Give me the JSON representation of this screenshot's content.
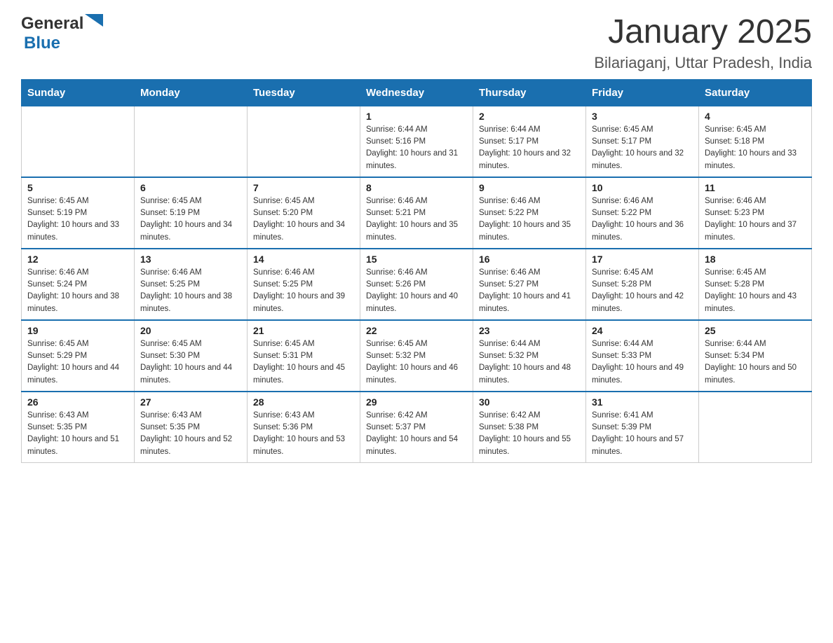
{
  "header": {
    "logo": {
      "text_general": "General",
      "text_blue": "Blue",
      "arrow_color": "#1a6faf"
    },
    "title": "January 2025",
    "subtitle": "Bilariaganj, Uttar Pradesh, India"
  },
  "days_of_week": [
    "Sunday",
    "Monday",
    "Tuesday",
    "Wednesday",
    "Thursday",
    "Friday",
    "Saturday"
  ],
  "weeks": [
    {
      "days": [
        {
          "num": "",
          "info": ""
        },
        {
          "num": "",
          "info": ""
        },
        {
          "num": "",
          "info": ""
        },
        {
          "num": "1",
          "info": "Sunrise: 6:44 AM\nSunset: 5:16 PM\nDaylight: 10 hours and 31 minutes."
        },
        {
          "num": "2",
          "info": "Sunrise: 6:44 AM\nSunset: 5:17 PM\nDaylight: 10 hours and 32 minutes."
        },
        {
          "num": "3",
          "info": "Sunrise: 6:45 AM\nSunset: 5:17 PM\nDaylight: 10 hours and 32 minutes."
        },
        {
          "num": "4",
          "info": "Sunrise: 6:45 AM\nSunset: 5:18 PM\nDaylight: 10 hours and 33 minutes."
        }
      ]
    },
    {
      "days": [
        {
          "num": "5",
          "info": "Sunrise: 6:45 AM\nSunset: 5:19 PM\nDaylight: 10 hours and 33 minutes."
        },
        {
          "num": "6",
          "info": "Sunrise: 6:45 AM\nSunset: 5:19 PM\nDaylight: 10 hours and 34 minutes."
        },
        {
          "num": "7",
          "info": "Sunrise: 6:45 AM\nSunset: 5:20 PM\nDaylight: 10 hours and 34 minutes."
        },
        {
          "num": "8",
          "info": "Sunrise: 6:46 AM\nSunset: 5:21 PM\nDaylight: 10 hours and 35 minutes."
        },
        {
          "num": "9",
          "info": "Sunrise: 6:46 AM\nSunset: 5:22 PM\nDaylight: 10 hours and 35 minutes."
        },
        {
          "num": "10",
          "info": "Sunrise: 6:46 AM\nSunset: 5:22 PM\nDaylight: 10 hours and 36 minutes."
        },
        {
          "num": "11",
          "info": "Sunrise: 6:46 AM\nSunset: 5:23 PM\nDaylight: 10 hours and 37 minutes."
        }
      ]
    },
    {
      "days": [
        {
          "num": "12",
          "info": "Sunrise: 6:46 AM\nSunset: 5:24 PM\nDaylight: 10 hours and 38 minutes."
        },
        {
          "num": "13",
          "info": "Sunrise: 6:46 AM\nSunset: 5:25 PM\nDaylight: 10 hours and 38 minutes."
        },
        {
          "num": "14",
          "info": "Sunrise: 6:46 AM\nSunset: 5:25 PM\nDaylight: 10 hours and 39 minutes."
        },
        {
          "num": "15",
          "info": "Sunrise: 6:46 AM\nSunset: 5:26 PM\nDaylight: 10 hours and 40 minutes."
        },
        {
          "num": "16",
          "info": "Sunrise: 6:46 AM\nSunset: 5:27 PM\nDaylight: 10 hours and 41 minutes."
        },
        {
          "num": "17",
          "info": "Sunrise: 6:45 AM\nSunset: 5:28 PM\nDaylight: 10 hours and 42 minutes."
        },
        {
          "num": "18",
          "info": "Sunrise: 6:45 AM\nSunset: 5:28 PM\nDaylight: 10 hours and 43 minutes."
        }
      ]
    },
    {
      "days": [
        {
          "num": "19",
          "info": "Sunrise: 6:45 AM\nSunset: 5:29 PM\nDaylight: 10 hours and 44 minutes."
        },
        {
          "num": "20",
          "info": "Sunrise: 6:45 AM\nSunset: 5:30 PM\nDaylight: 10 hours and 44 minutes."
        },
        {
          "num": "21",
          "info": "Sunrise: 6:45 AM\nSunset: 5:31 PM\nDaylight: 10 hours and 45 minutes."
        },
        {
          "num": "22",
          "info": "Sunrise: 6:45 AM\nSunset: 5:32 PM\nDaylight: 10 hours and 46 minutes."
        },
        {
          "num": "23",
          "info": "Sunrise: 6:44 AM\nSunset: 5:32 PM\nDaylight: 10 hours and 48 minutes."
        },
        {
          "num": "24",
          "info": "Sunrise: 6:44 AM\nSunset: 5:33 PM\nDaylight: 10 hours and 49 minutes."
        },
        {
          "num": "25",
          "info": "Sunrise: 6:44 AM\nSunset: 5:34 PM\nDaylight: 10 hours and 50 minutes."
        }
      ]
    },
    {
      "days": [
        {
          "num": "26",
          "info": "Sunrise: 6:43 AM\nSunset: 5:35 PM\nDaylight: 10 hours and 51 minutes."
        },
        {
          "num": "27",
          "info": "Sunrise: 6:43 AM\nSunset: 5:35 PM\nDaylight: 10 hours and 52 minutes."
        },
        {
          "num": "28",
          "info": "Sunrise: 6:43 AM\nSunset: 5:36 PM\nDaylight: 10 hours and 53 minutes."
        },
        {
          "num": "29",
          "info": "Sunrise: 6:42 AM\nSunset: 5:37 PM\nDaylight: 10 hours and 54 minutes."
        },
        {
          "num": "30",
          "info": "Sunrise: 6:42 AM\nSunset: 5:38 PM\nDaylight: 10 hours and 55 minutes."
        },
        {
          "num": "31",
          "info": "Sunrise: 6:41 AM\nSunset: 5:39 PM\nDaylight: 10 hours and 57 minutes."
        },
        {
          "num": "",
          "info": ""
        }
      ]
    }
  ]
}
